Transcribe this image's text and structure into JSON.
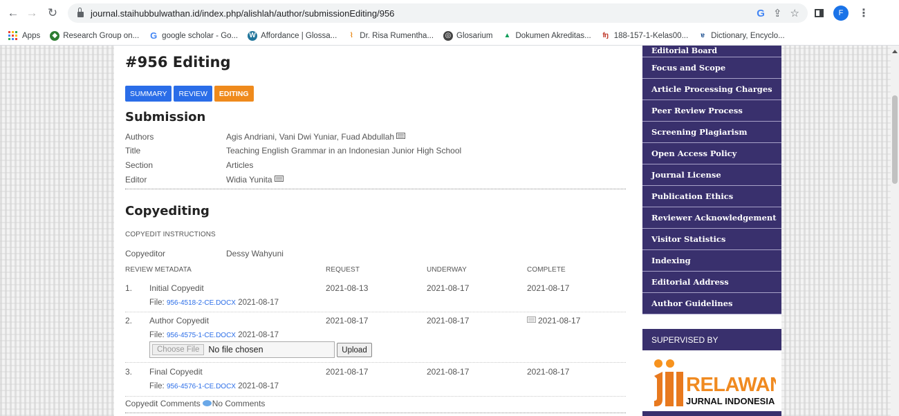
{
  "browser": {
    "url": "journal.staihubbulwathan.id/index.php/alishlah/author/submissionEditing/956",
    "profile_initial": "F",
    "bookmarks": [
      {
        "label": "Apps",
        "icon": "apps-grid-icon"
      },
      {
        "label": "Research Group on...",
        "icon": "researchgate-icon"
      },
      {
        "label": "google scholar - Go...",
        "icon": "google-icon"
      },
      {
        "label": "Affordance | Glossa...",
        "icon": "wordpress-icon"
      },
      {
        "label": "Dr. Risa Rumentha...",
        "icon": "site-icon"
      },
      {
        "label": "Glosarium",
        "icon": "globe-icon"
      },
      {
        "label": "Dokumen Akreditas...",
        "icon": "google-drive-icon"
      },
      {
        "label": "188-157-1-Kelas00...",
        "icon": "document-icon"
      },
      {
        "label": "Dictionary, Encyclo...",
        "icon": "dictionary-icon"
      }
    ]
  },
  "page": {
    "title": "#956 Editing",
    "tabs": [
      {
        "label": "SUMMARY",
        "active": false
      },
      {
        "label": "REVIEW",
        "active": false
      },
      {
        "label": "EDITING",
        "active": true
      }
    ],
    "submission": {
      "heading": "Submission",
      "rows": [
        {
          "label": "Authors",
          "value": "Agis Andriani, Vani Dwi Yuniar, Fuad Abdullah"
        },
        {
          "label": "Title",
          "value": "Teaching English Grammar in an Indonesian Junior High School"
        },
        {
          "label": "Section",
          "value": "Articles"
        },
        {
          "label": "Editor",
          "value": "Widia Yunita"
        }
      ]
    },
    "copyediting": {
      "heading": "Copyediting",
      "instructions_link": "COPYEDIT INSTRUCTIONS",
      "copyeditor_label": "Copyeditor",
      "copyeditor_name": "Dessy Wahyuni",
      "columns": [
        "REVIEW METADATA",
        "REQUEST",
        "UNDERWAY",
        "COMPLETE"
      ],
      "steps": [
        {
          "num": "1.",
          "name": "Initial Copyedit",
          "request": "2021-08-13",
          "underway": "2021-08-17",
          "complete": "2021-08-17",
          "file_label": "File:",
          "file_name": "956-4518-2-CE.DOCX",
          "file_date": "2021-08-17"
        },
        {
          "num": "2.",
          "name": "Author Copyedit",
          "request": "2021-08-17",
          "underway": "2021-08-17",
          "complete": "2021-08-17",
          "file_label": "File:",
          "file_name": "956-4575-1-CE.DOCX",
          "file_date": "2021-08-17"
        },
        {
          "num": "3.",
          "name": "Final Copyedit",
          "request": "2021-08-17",
          "underway": "2021-08-17",
          "complete": "2021-08-17",
          "file_label": "File:",
          "file_name": "956-4576-1-CE.DOCX",
          "file_date": "2021-08-17"
        }
      ],
      "choose_file": "Choose File",
      "no_file": "No file chosen",
      "upload": "Upload",
      "comments_label": "Copyedit Comments",
      "comments_value": "No Comments"
    }
  },
  "sidebar": {
    "items": [
      "Editorial Board",
      "Focus and Scope",
      "Article Processing Charges",
      "Peer Review Process",
      "Screening Plagiarism",
      "Open Access Policy",
      "Journal License",
      "Publication Ethics",
      "Reviewer Acknowledgement",
      "Visitor Statistics",
      "Indexing",
      "Editorial Address",
      "Author Guidelines"
    ],
    "supervised_by": "SUPERVISED BY",
    "logo_text_main": "RELAWAN",
    "logo_text_sub": "JURNAL INDONESIA"
  }
}
